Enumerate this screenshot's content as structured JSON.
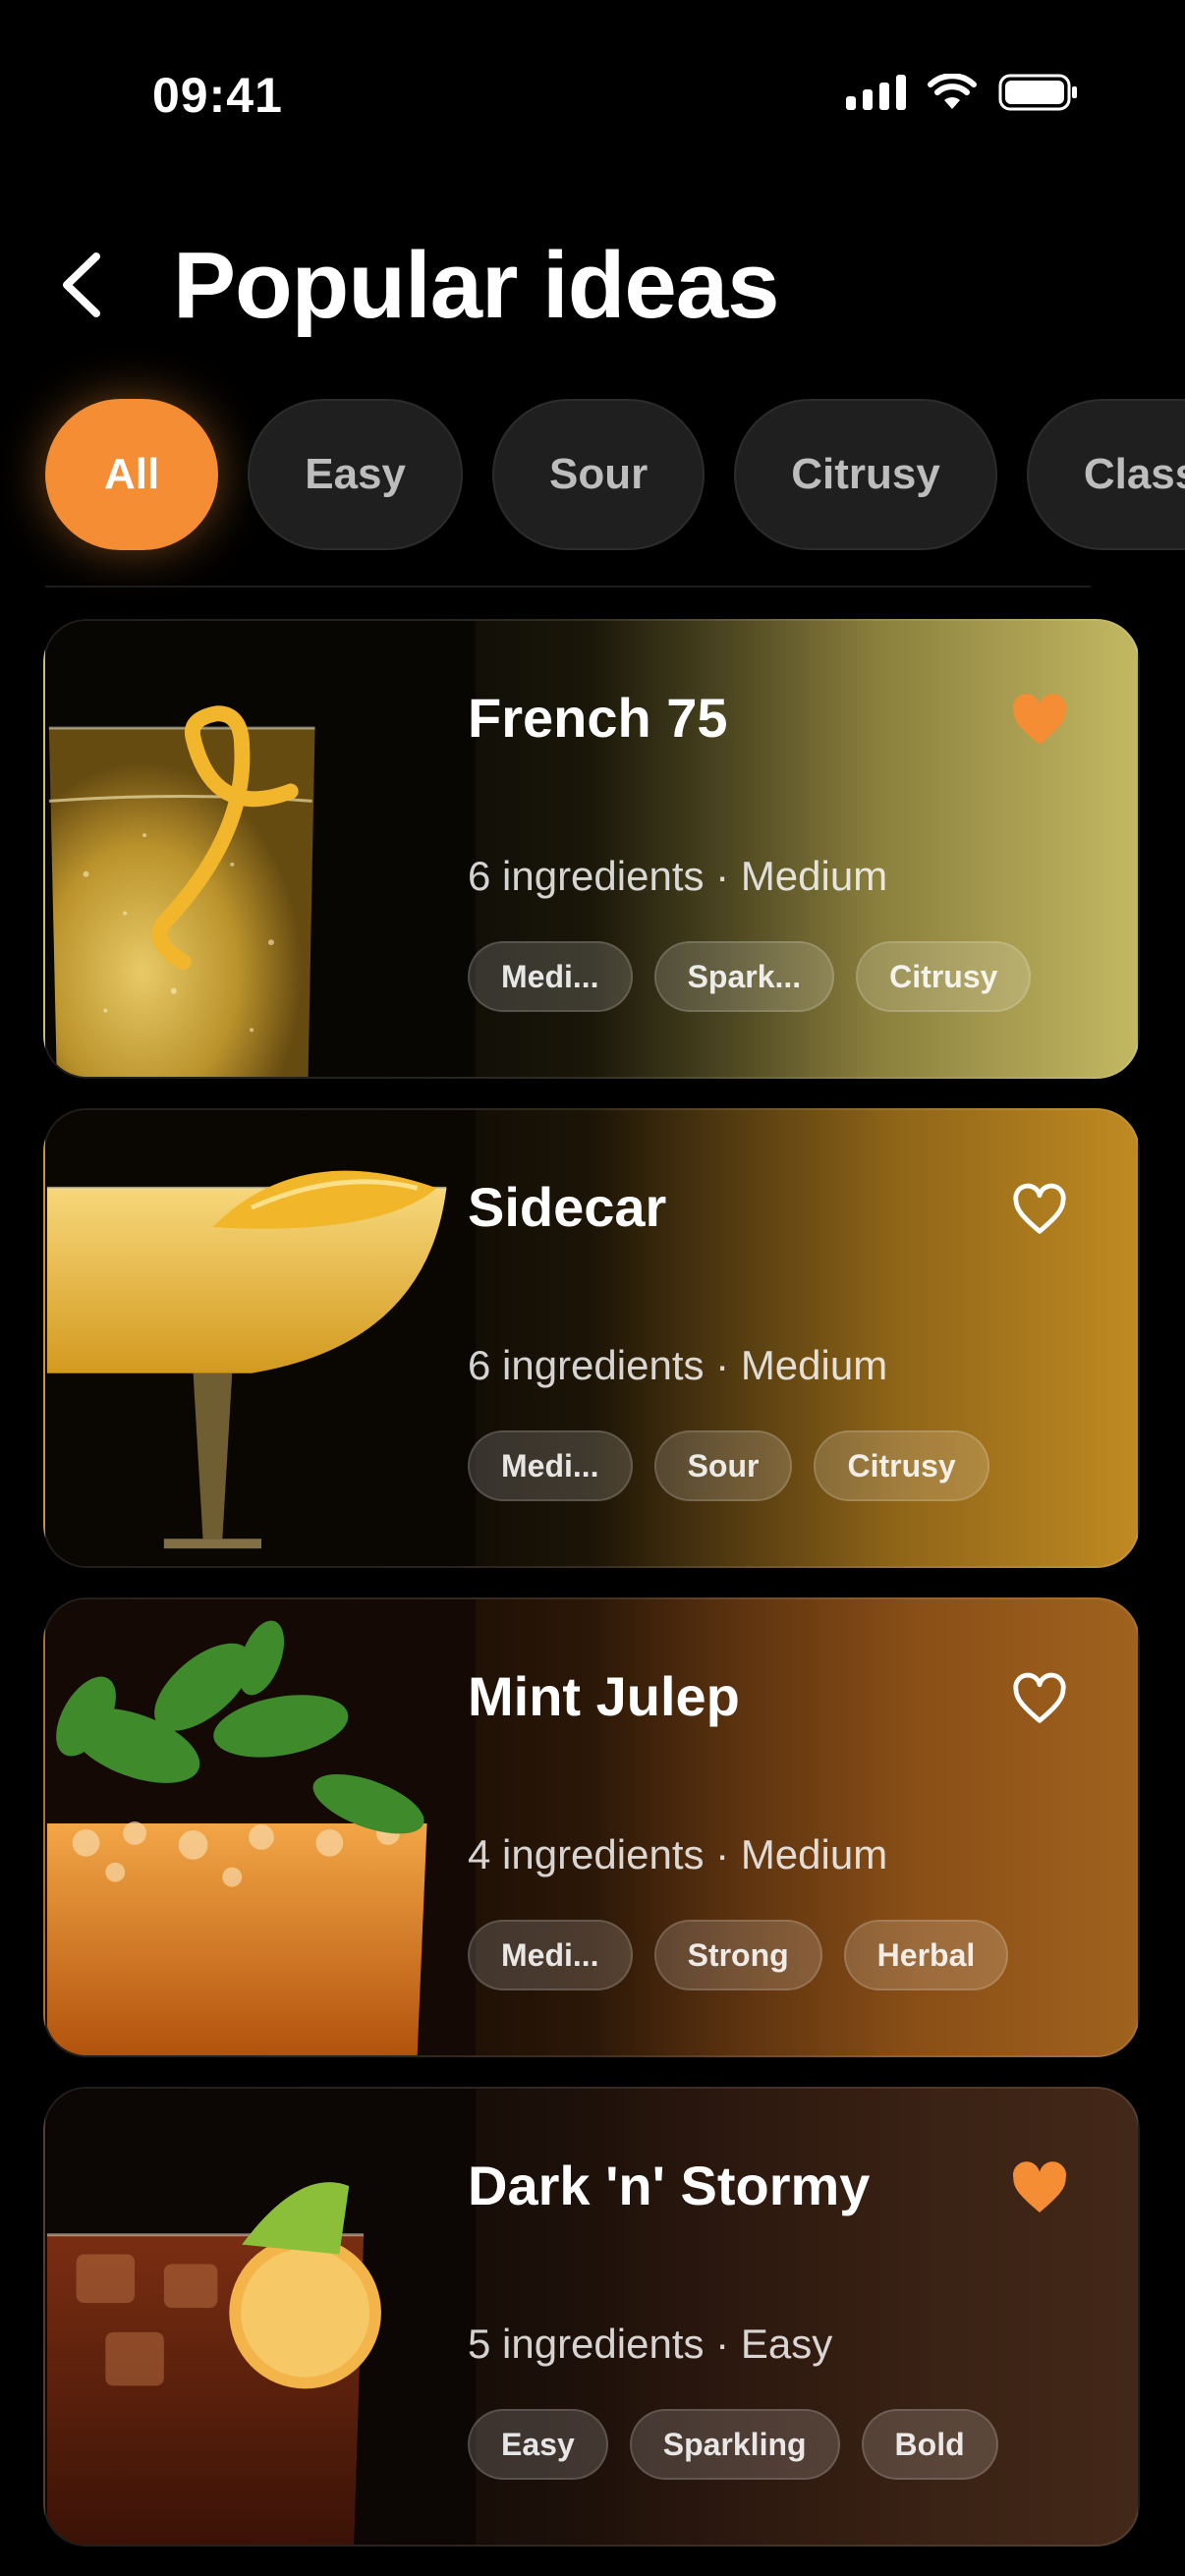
{
  "status_bar": {
    "time": "09:41"
  },
  "header": {
    "title": "Popular ideas",
    "back_icon": "chevron-left-icon"
  },
  "filters": {
    "accent": "#f48d33",
    "chips": [
      {
        "label": "All",
        "active": true
      },
      {
        "label": "Easy",
        "active": false
      },
      {
        "label": "Sour",
        "active": false
      },
      {
        "label": "Citrusy",
        "active": false
      },
      {
        "label": "Class",
        "active": false
      }
    ]
  },
  "cards": [
    {
      "title": "French 75",
      "meta": "6 ingredients · Medium",
      "favorited": true,
      "tags": [
        "Medi...",
        "Spark...",
        "Citrusy"
      ]
    },
    {
      "title": "Sidecar",
      "meta": "6 ingredients · Medium",
      "favorited": false,
      "tags": [
        "Medi...",
        "Sour",
        "Citrusy"
      ]
    },
    {
      "title": "Mint Julep",
      "meta": "4 ingredients · Medium",
      "favorited": false,
      "tags": [
        "Medi...",
        "Strong",
        "Herbal"
      ]
    },
    {
      "title": "Dark 'n' Stormy",
      "meta": "5 ingredients · Easy",
      "favorited": true,
      "tags": [
        "Easy",
        "Sparkling",
        "Bold"
      ]
    }
  ]
}
